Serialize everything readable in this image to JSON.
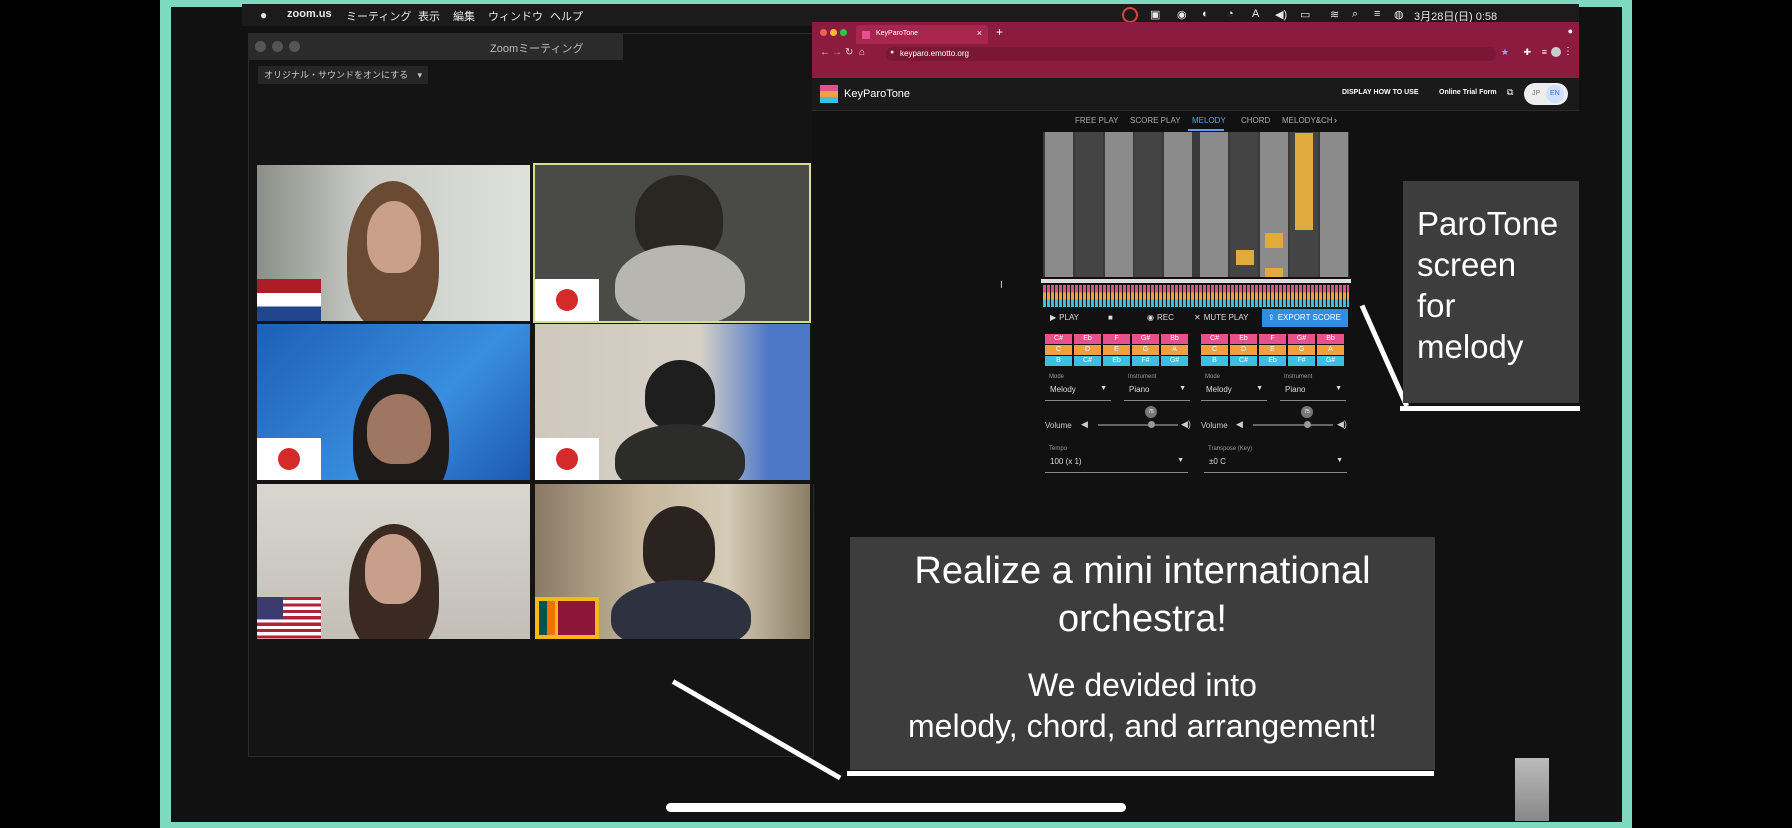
{
  "menubar": {
    "app_name": "zoom.us",
    "items": [
      "ミーティング",
      "表示",
      "編集",
      "ウィンドウ",
      "ヘルプ"
    ],
    "clock": "3月28日(日) 0:58"
  },
  "zoom": {
    "window_title": "Zoomミーティング",
    "audio_dropdown": "オリジナル・サウンドをオンにする"
  },
  "browser": {
    "tab_title": "KeyParoTone",
    "url": "keyparo.emotto.org"
  },
  "app": {
    "name": "KeyParoTone",
    "how_to": "DISPLAY HOW TO USE",
    "trial": "Online Trial Form",
    "lang_jp": "JP",
    "lang_en": "EN",
    "tabs": [
      "FREE PLAY",
      "SCORE PLAY",
      "MELODY",
      "CHORD",
      "MELODY&CH"
    ],
    "active_tab": "MELODY",
    "play": "PLAY",
    "rec": "REC",
    "mute_play": "MUTE PLAY",
    "export": "EXPORT SCORE",
    "note_grid_left": [
      [
        "C#",
        "Eb",
        "F",
        "G#",
        "Bb"
      ],
      [
        "C",
        "D",
        "E",
        "G",
        "A"
      ],
      [
        "B",
        "C#",
        "Eb",
        "F#",
        "G#"
      ]
    ],
    "note_grid_right": [
      [
        "C#",
        "Eb",
        "F",
        "G#",
        "Bb"
      ],
      [
        "C",
        "D",
        "E",
        "G",
        "A"
      ],
      [
        "B",
        "C#",
        "Eb",
        "F#",
        "G#"
      ]
    ],
    "mode_label": "Mode",
    "mode_value": "Melody",
    "instrument_label": "Instrument",
    "instrument_value": "Piano",
    "volume_label": "Volume",
    "volume_value": "75",
    "tempo_label": "Tempo",
    "tempo_value": "100   (x 1)",
    "transpose_label": "Transpose (Key)",
    "transpose_value": "±0   C"
  },
  "callout_right": "ParoTone\nscreen\nfor\nmelody",
  "callout_bottom": {
    "line1": "Realize a mini international",
    "line2": "orchestra!",
    "line3": "We devided into",
    "line4": "melody, chord, and arrangement!"
  },
  "colors": {
    "frame": "#7ed9bf",
    "browser_bar": "#8c1c3f",
    "accent_blue": "#2e8de4",
    "note_pink": "#e8508c",
    "note_orange": "#f0a040",
    "note_cyan": "#3cc0e0"
  }
}
